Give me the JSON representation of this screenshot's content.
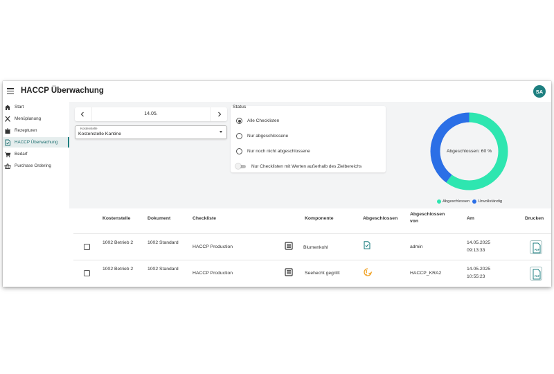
{
  "app": {
    "title": "HACCP Überwachung",
    "avatar_initials": "SA"
  },
  "sidebar": {
    "items": [
      {
        "label": "Start",
        "icon": "home-icon",
        "active": false
      },
      {
        "label": "Menüplanung",
        "icon": "cutlery-icon",
        "active": false
      },
      {
        "label": "Rezepturen",
        "icon": "pot-icon",
        "active": false
      },
      {
        "label": "HACCP Überwachung",
        "icon": "checklist-icon",
        "active": true
      },
      {
        "label": "Bedarf",
        "icon": "cart-icon",
        "active": false
      },
      {
        "label": "Purchase Ordering",
        "icon": "basket-icon",
        "active": false
      }
    ]
  },
  "filters": {
    "date": "14.05.",
    "kostenstelle_label": "Kostenstelle",
    "kostenstelle_value": "Kostenstelle Kantine"
  },
  "status": {
    "title": "Status",
    "options": [
      {
        "label": "Alle Checklisten",
        "selected": true
      },
      {
        "label": "Nur abgeschlossene",
        "selected": false
      },
      {
        "label": "Nur noch nicht abgeschlossene",
        "selected": false
      }
    ],
    "toggle_label": "Nur Checklisten mit Werten außerhalb des Zielbereichs",
    "toggle_on": false
  },
  "chart": {
    "center_label": "Abgeschlossen: 60 %",
    "completed_fraction": 0.6,
    "legend": [
      {
        "label": "Abgeschlossen",
        "color": "#2ee6b0"
      },
      {
        "label": "Unvollständig",
        "color": "#2b6fe6"
      }
    ]
  },
  "table": {
    "headers": [
      "Kostenstelle",
      "Dokument",
      "Checkliste",
      "Komponente",
      "Abgeschlossen",
      "Abgeschlossen von",
      "Am",
      "Drucken"
    ],
    "rows": [
      {
        "kostenstelle": "1002 Betrieb 2",
        "dokument": "1002 Standard",
        "checkliste": "HACCP Production",
        "komponente": "Blumenkohl",
        "status_icon": "completed-check-icon",
        "abgeschlossen_von": "admin",
        "am_date": "14.05.2025",
        "am_time": "09:13:33",
        "pdf_label": "PDF"
      },
      {
        "kostenstelle": "1002 Betrieb 2",
        "dokument": "1002 Standard",
        "checkliste": "HACCP Production",
        "komponente": "Seehecht gegrillt",
        "status_icon": "warning-clock-icon",
        "abgeschlossen_von": "HACCP_KRA2",
        "am_date": "14.05.2025",
        "am_time": "10:55:23",
        "pdf_label": "PDF"
      }
    ]
  },
  "colors": {
    "accent": "#1e7f80",
    "completed": "#2ee6b0",
    "incomplete": "#2b6fe6",
    "warning": "#f0a020"
  }
}
